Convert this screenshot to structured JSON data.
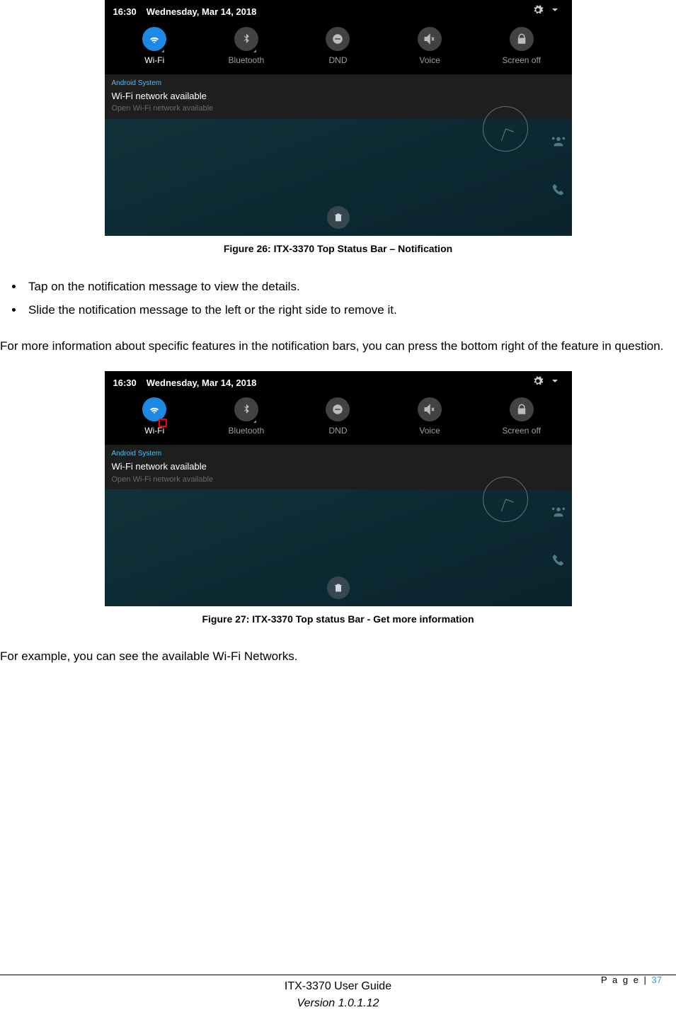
{
  "screenshot": {
    "statusbar": {
      "time": "16:30",
      "date": "Wednesday, Mar 14, 2018"
    },
    "toggles": [
      {
        "label": "Wi-Fi",
        "icon": "wifi",
        "active": true,
        "expand": true
      },
      {
        "label": "Bluetooth",
        "icon": "bluetooth",
        "active": false,
        "expand": true
      },
      {
        "label": "DND",
        "icon": "dnd",
        "active": false,
        "expand": false
      },
      {
        "label": "Voice",
        "icon": "voice",
        "active": false,
        "expand": false
      },
      {
        "label": "Screen off",
        "icon": "lock",
        "active": false,
        "expand": false
      }
    ],
    "notification": {
      "system": "Android System",
      "title": "Wi-Fi network available",
      "subtitle": "Open Wi-Fi network available"
    }
  },
  "figcap1": "Figure 26: ITX-3370 Top Status Bar – Notification",
  "bullets": [
    "Tap on the notification message to view the details.",
    "Slide the notification message to the left or the right side to remove it."
  ],
  "para1": "For more information about specific features in the notification bars, you can press the bottom right of the feature in question.",
  "figcap2": "Figure 27: ITX-3370 Top status Bar - Get more information",
  "para2": "For example, you can see the available Wi-Fi Networks.",
  "footer": {
    "title": "ITX-3370 User Guide",
    "version": "Version 1.0.1.12",
    "page_label": "P a g e | ",
    "page_num": "37"
  }
}
